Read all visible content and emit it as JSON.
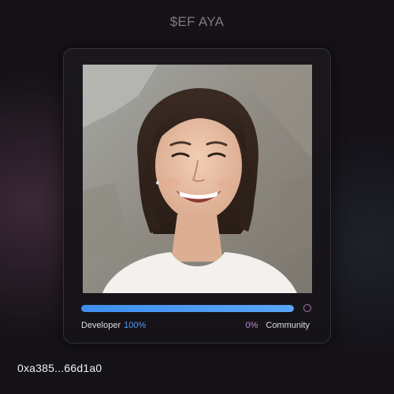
{
  "token": {
    "title": "$EF AYA"
  },
  "card": {
    "image_alt": "Portrait photo of a smiling woman",
    "allocation": {
      "developer_label": "Developer",
      "developer_percent_text": "100%",
      "developer_fraction": 1.0,
      "community_label": "Community",
      "community_percent_text": "0%"
    },
    "colors": {
      "developer_accent": "#4f9cff",
      "community_accent": "#c28ad6"
    }
  },
  "footer": {
    "address": "0xa385...66d1a0"
  }
}
